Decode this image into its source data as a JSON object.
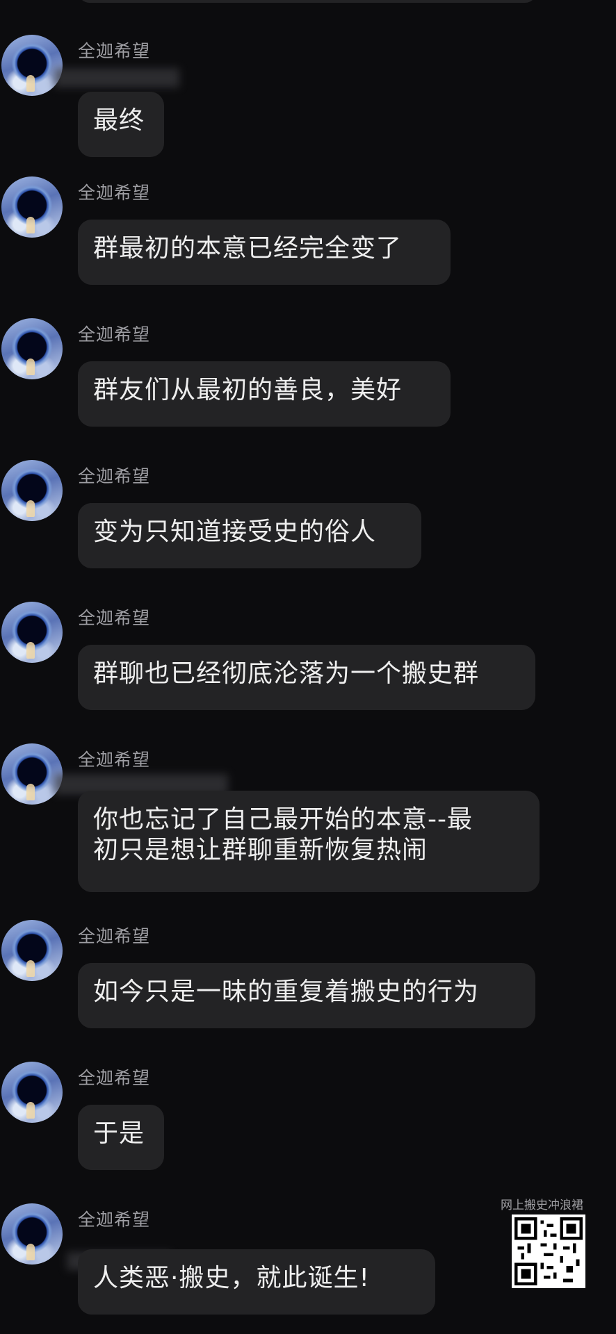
{
  "chat": {
    "messages": [
      {
        "sender": "全迦希望",
        "text": "最终"
      },
      {
        "sender": "全迦希望",
        "text": "群最初的本意已经完全变了"
      },
      {
        "sender": "全迦希望",
        "text": "群友们从最初的善良，美好"
      },
      {
        "sender": "全迦希望",
        "text": "变为只知道接受史的俗人"
      },
      {
        "sender": "全迦希望",
        "text": "群聊也已经彻底沦落为一个搬史群"
      },
      {
        "sender": "全迦希望",
        "text_line1": "你也忘记了自己最开始的本意--最",
        "text_line2": "初只是想让群聊重新恢复热闹"
      },
      {
        "sender": "全迦希望",
        "text": "如今只是一昧的重复着搬史的行为"
      },
      {
        "sender": "全迦希望",
        "text": "于是"
      },
      {
        "sender": "全迦希望",
        "text": "人类恶·搬史，就此诞生!"
      }
    ]
  },
  "watermark": {
    "text": "网上搬史冲浪裙",
    "qr_icon": "qr-code-icon"
  },
  "colors": {
    "background": "#0c0c0e",
    "bubble": "#232325",
    "sender": "#9e9ea3",
    "text": "#eeeeee"
  }
}
